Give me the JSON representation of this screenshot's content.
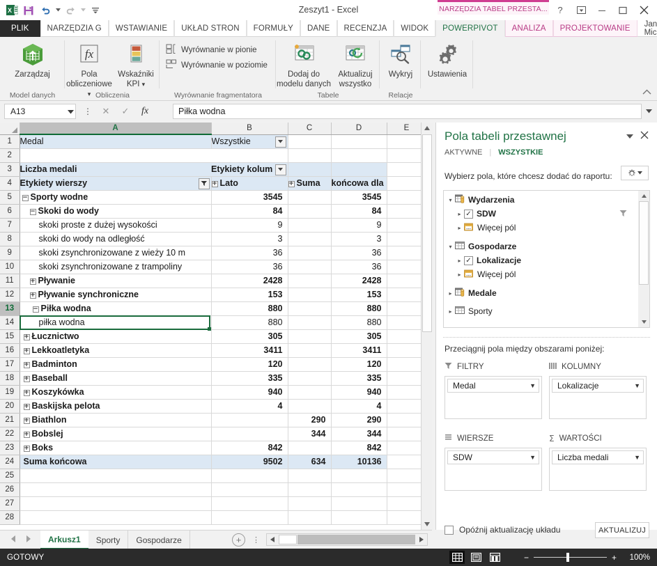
{
  "window": {
    "title": "Zeszyt1 - Excel",
    "contextual_tab_group": "NARZĘDZIA TABEL PRZESTA...",
    "user_name": "Jan Mich...",
    "quick_access": [
      "excel-logo",
      "save-icon",
      "undo-icon",
      "redo-icon",
      "customize-qat-icon"
    ],
    "controls": [
      "help-icon",
      "ribbon-display-options-icon",
      "minimize-icon",
      "maximize-icon",
      "close-icon"
    ]
  },
  "ribbon": {
    "tabs": [
      {
        "label": "PLIK",
        "kind": "file"
      },
      {
        "label": "NARZĘDZIA G",
        "kind": "normal"
      },
      {
        "label": "WSTAWIANIE",
        "kind": "normal"
      },
      {
        "label": "UKŁAD STRON",
        "kind": "normal"
      },
      {
        "label": "FORMUŁY",
        "kind": "normal"
      },
      {
        "label": "DANE",
        "kind": "normal"
      },
      {
        "label": "RECENZJA",
        "kind": "normal"
      },
      {
        "label": "WIDOK",
        "kind": "normal"
      },
      {
        "label": "POWERPIVOT",
        "kind": "active"
      },
      {
        "label": "ANALIZA",
        "kind": "ctx"
      },
      {
        "label": "PROJEKTOWANIE",
        "kind": "ctx"
      }
    ],
    "groups": [
      {
        "caption": "Model danych",
        "buttons": [
          {
            "label": "Zarządzaj",
            "icon": "manage-model-icon"
          }
        ]
      },
      {
        "caption": "Obliczenia",
        "buttons": [
          {
            "label": "Pola\nobliczeniowe",
            "icon": "calculated-fields-icon"
          },
          {
            "label": "Wskaźniki\nKPI",
            "icon": "kpi-icon"
          }
        ]
      },
      {
        "caption": "Wyrównanie fragmentatora",
        "buttons": [
          {
            "label": "Wyrównanie w pionie",
            "icon": "align-vertical-icon"
          },
          {
            "label": "Wyrównanie w poziomie",
            "icon": "align-horizontal-icon"
          }
        ]
      },
      {
        "caption": "Tabele",
        "buttons": [
          {
            "label": "Dodaj do\nmodelu danych",
            "icon": "add-to-data-model-icon"
          },
          {
            "label": "Aktualizuj\nwszystko",
            "icon": "update-all-icon"
          }
        ]
      },
      {
        "caption": "Relacje",
        "buttons": [
          {
            "label": "Wykryj",
            "icon": "detect-relationships-icon"
          }
        ]
      },
      {
        "caption": "",
        "buttons": [
          {
            "label": "Ustawienia",
            "icon": "settings-gear-icon"
          }
        ]
      }
    ],
    "group_labels": {
      "model": "Model danych",
      "calc": "Obliczenia",
      "slicer": "Wyrównanie fragmentatora",
      "tables": "Tabele",
      "relations": "Relacje",
      "manage": "Zarządzaj",
      "calc_fields": "Pola",
      "calc_fields2": "obliczeniowe",
      "kpi1": "Wskaźniki",
      "kpi2": "KPI",
      "align_v": "Wyrównanie w pionie",
      "align_h": "Wyrównanie w poziomie",
      "add_model1": "Dodaj do",
      "add_model2": "modelu danych",
      "update1": "Aktualizuj",
      "update2": "wszystko",
      "detect": "Wykryj",
      "settings": "Ustawienia"
    }
  },
  "formula_bar": {
    "name_box": "A13",
    "value": "Piłka wodna",
    "cancel_icon": "cancel-icon",
    "accept_icon": "accept-icon",
    "fx_icon": "insert-function-icon"
  },
  "grid": {
    "columns": [
      "A",
      "B",
      "C",
      "D",
      "E"
    ],
    "selected_column": "A",
    "selected_row": 13,
    "rows": [
      {
        "n": 1,
        "style": "pt-lite",
        "a": {
          "text": "Medal",
          "bold": false
        },
        "b": {
          "text": "Wszystkie",
          "filter": true
        },
        "c": "",
        "d": "",
        "e": ""
      },
      {
        "n": 2,
        "style": "plain",
        "a": {
          "text": ""
        },
        "b": {
          "text": ""
        },
        "c": "",
        "d": "",
        "e": ""
      },
      {
        "n": 3,
        "style": "pt",
        "a": {
          "text": "Liczba medali",
          "bold": true
        },
        "b": {
          "text": "Etykiety kolum",
          "bold": true,
          "filter": true
        },
        "c": "",
        "d": "",
        "e": ""
      },
      {
        "n": 4,
        "style": "pt",
        "a": {
          "text": "Etykiety wierszy",
          "bold": true,
          "rowfilter": true
        },
        "b": {
          "text": "Lato",
          "bold": true,
          "plus": true
        },
        "c": {
          "text": "Suma",
          "bold": true,
          "plus": true
        },
        "d": {
          "text": "końcowa dla",
          "bold": true
        },
        "e": ""
      },
      {
        "n": 5,
        "style": "plain",
        "a": {
          "text": "Sporty wodne",
          "bold": true,
          "indent": 0,
          "toggle": "minus"
        },
        "b": "3545",
        "c": "",
        "d": "3545",
        "e": "",
        "bold": true
      },
      {
        "n": 6,
        "style": "plain",
        "a": {
          "text": "Skoki do wody",
          "bold": true,
          "indent": 1,
          "toggle": "minus"
        },
        "b": "84",
        "c": "",
        "d": "84",
        "e": "",
        "bold": true
      },
      {
        "n": 7,
        "style": "plain",
        "a": {
          "text": "skoki proste z dużej wysokości",
          "indent": 2
        },
        "b": "9",
        "c": "",
        "d": "9",
        "e": ""
      },
      {
        "n": 8,
        "style": "plain",
        "a": {
          "text": "skoki do wody na odległość",
          "indent": 2
        },
        "b": "3",
        "c": "",
        "d": "3",
        "e": ""
      },
      {
        "n": 9,
        "style": "plain",
        "a": {
          "text": "skoki zsynchronizowane z wieży 10 m",
          "indent": 2
        },
        "b": "36",
        "c": "",
        "d": "36",
        "e": ""
      },
      {
        "n": 10,
        "style": "plain",
        "a": {
          "text": "skoki zsynchronizowane z trampoliny",
          "indent": 2
        },
        "b": "36",
        "c": "",
        "d": "36",
        "e": ""
      },
      {
        "n": 11,
        "style": "plain",
        "a": {
          "text": "Pływanie",
          "bold": true,
          "indent": 1,
          "toggle": "plus"
        },
        "b": "2428",
        "c": "",
        "d": "2428",
        "e": "",
        "bold": true
      },
      {
        "n": 12,
        "style": "plain",
        "a": {
          "text": "Pływanie synchroniczne",
          "bold": true,
          "indent": 1,
          "toggle": "plus"
        },
        "b": "153",
        "c": "",
        "d": "153",
        "e": "",
        "bold": true
      },
      {
        "n": 13,
        "style": "plain",
        "a": {
          "text": "Piłka wodna",
          "bold": true,
          "indent": 1,
          "toggle": "minus"
        },
        "b": "880",
        "c": "",
        "d": "880",
        "e": "",
        "bold": true
      },
      {
        "n": 14,
        "style": "plain",
        "a": {
          "text": "piłka wodna",
          "indent": 2
        },
        "b": "880",
        "c": "",
        "d": "880",
        "e": ""
      },
      {
        "n": 15,
        "style": "plain",
        "a": {
          "text": "Łucznictwo",
          "bold": true,
          "indent": 0,
          "toggle": "plus"
        },
        "b": "305",
        "c": "",
        "d": "305",
        "e": "",
        "bold": true
      },
      {
        "n": 16,
        "style": "plain",
        "a": {
          "text": "Lekkoatletyka",
          "bold": true,
          "indent": 0,
          "toggle": "plus"
        },
        "b": "3411",
        "c": "",
        "d": "3411",
        "e": "",
        "bold": true
      },
      {
        "n": 17,
        "style": "plain",
        "a": {
          "text": "Badminton",
          "bold": true,
          "indent": 0,
          "toggle": "plus"
        },
        "b": "120",
        "c": "",
        "d": "120",
        "e": "",
        "bold": true
      },
      {
        "n": 18,
        "style": "plain",
        "a": {
          "text": "Baseball",
          "bold": true,
          "indent": 0,
          "toggle": "plus"
        },
        "b": "335",
        "c": "",
        "d": "335",
        "e": "",
        "bold": true
      },
      {
        "n": 19,
        "style": "plain",
        "a": {
          "text": "Koszykówka",
          "bold": true,
          "indent": 0,
          "toggle": "plus"
        },
        "b": "940",
        "c": "",
        "d": "940",
        "e": "",
        "bold": true
      },
      {
        "n": 20,
        "style": "plain",
        "a": {
          "text": "Baskijska pelota",
          "bold": true,
          "indent": 0,
          "toggle": "plus"
        },
        "b": "4",
        "c": "",
        "d": "4",
        "e": "",
        "bold": true
      },
      {
        "n": 21,
        "style": "plain",
        "a": {
          "text": "Biathlon",
          "bold": true,
          "indent": 0,
          "toggle": "plus"
        },
        "b": "",
        "c": "290",
        "d": "290",
        "e": "",
        "bold": true
      },
      {
        "n": 22,
        "style": "plain",
        "a": {
          "text": "Bobslej",
          "bold": true,
          "indent": 0,
          "toggle": "plus"
        },
        "b": "",
        "c": "344",
        "d": "344",
        "e": "",
        "bold": true
      },
      {
        "n": 23,
        "style": "plain",
        "a": {
          "text": "Boks",
          "bold": true,
          "indent": 0,
          "toggle": "plus"
        },
        "b": "842",
        "c": "",
        "d": "842",
        "e": "",
        "bold": true
      },
      {
        "n": 24,
        "style": "pt",
        "a": {
          "text": "Suma końcowa",
          "bold": true,
          "indent": 0
        },
        "b": "9502",
        "c": "634",
        "d": "10136",
        "e": "",
        "bold": true
      },
      {
        "n": 25,
        "style": "plain",
        "a": {
          "text": ""
        },
        "b": "",
        "c": "",
        "d": "",
        "e": ""
      },
      {
        "n": 26,
        "style": "plain",
        "a": {
          "text": ""
        },
        "b": "",
        "c": "",
        "d": "",
        "e": ""
      },
      {
        "n": 27,
        "style": "plain",
        "a": {
          "text": ""
        },
        "b": "",
        "c": "",
        "d": "",
        "e": ""
      },
      {
        "n": 28,
        "style": "plain",
        "a": {
          "text": ""
        },
        "b": "",
        "c": "",
        "d": "",
        "e": ""
      }
    ]
  },
  "pane": {
    "title": "Pola tabeli przestawnej",
    "collapse_icon": "chevron-down-icon",
    "close_icon": "close-icon",
    "tabs": [
      {
        "label": "AKTYWNE",
        "active": false
      },
      {
        "label": "WSZYSTKIE",
        "active": true
      }
    ],
    "subtitle": "Wybierz pola, które chcesz dodać do raportu:",
    "tools_icon": "gear-icon",
    "field_tree": [
      {
        "label": "Wydarzenia",
        "level": 0,
        "bold": true,
        "icon": "table-data-icon",
        "arrow": "expanded",
        "checkbox": false
      },
      {
        "label": "SDW",
        "level": 1,
        "bold": true,
        "icon": "",
        "arrow": "collapsed",
        "checkbox": true,
        "checked": true,
        "filter": true
      },
      {
        "label": "Więcej pól",
        "level": 1,
        "bold": false,
        "icon": "more-fields-icon",
        "arrow": "collapsed",
        "checkbox": false
      },
      {
        "label": "Gospodarze",
        "level": 0,
        "bold": true,
        "icon": "table-icon",
        "arrow": "expanded",
        "checkbox": false
      },
      {
        "label": "Lokalizacje",
        "level": 1,
        "bold": true,
        "icon": "",
        "arrow": "collapsed",
        "checkbox": true,
        "checked": true
      },
      {
        "label": "Więcej pól",
        "level": 1,
        "bold": false,
        "icon": "more-fields-icon",
        "arrow": "collapsed",
        "checkbox": false
      },
      {
        "label": "Medale",
        "level": 0,
        "bold": true,
        "icon": "table-data-icon",
        "arrow": "collapsed",
        "checkbox": false
      },
      {
        "label": "Sporty",
        "level": 0,
        "bold": false,
        "icon": "table-icon",
        "arrow": "collapsed",
        "checkbox": false
      }
    ],
    "drag_hint": "Przeciągnij pola między obszarami poniżej:",
    "zones": [
      {
        "key": "filters",
        "title": "FILTRY",
        "icon": "filter-icon",
        "items": [
          "Medal"
        ]
      },
      {
        "key": "columns",
        "title": "KOLUMNY",
        "icon": "columns-icon",
        "items": [
          "Lokalizacje"
        ]
      },
      {
        "key": "rows",
        "title": "WIERSZE",
        "icon": "rows-icon",
        "items": [
          "SDW"
        ]
      },
      {
        "key": "values",
        "title": "WARTOŚCI",
        "icon": "sigma-icon",
        "items": [
          "Liczba medali"
        ]
      }
    ],
    "defer_label": "Opóźnij aktualizację układu",
    "update_button": "AKTUALIZUJ"
  },
  "sheet_tabs": {
    "tabs": [
      {
        "label": "Arkusz1",
        "active": true
      },
      {
        "label": "Sporty",
        "active": false
      },
      {
        "label": "Gospodarze",
        "active": false
      }
    ],
    "add_icon": "add-sheet-icon",
    "menu_icon": "sheet-menu-icon"
  },
  "status_bar": {
    "status": "GOTOWY",
    "views": [
      {
        "name": "normal-view-icon",
        "active": true
      },
      {
        "name": "page-layout-view-icon",
        "active": false
      },
      {
        "name": "page-break-view-icon",
        "active": false
      }
    ],
    "zoom_out": "−",
    "zoom_in": "+",
    "zoom_level": "100%"
  },
  "colors": {
    "excel_green": "#217346",
    "pivot_header_blue": "#dce8f4",
    "contextual_pink": "#cf3d91",
    "status_dark": "#2b2b2b"
  }
}
